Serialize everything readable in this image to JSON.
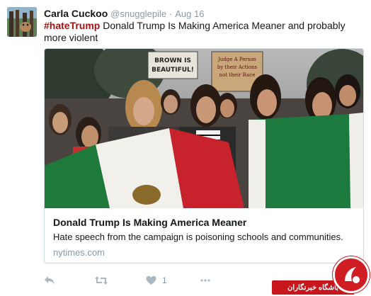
{
  "tweet": {
    "author_name": "Carla Cuckoo",
    "author_handle": "@snugglepile",
    "separator": "·",
    "timestamp": "Aug 16",
    "hashtag": "#hateTrump",
    "text": " Donald Trump Is Making America Meaner and probably more violent"
  },
  "card": {
    "image_signs": [
      "BROWN IS BEAUTIFUL!",
      "Judge A Person by their Actions not their Race"
    ],
    "title": "Donald Trump Is Making America Meaner",
    "description": "Hate speech from the campaign is poisoning schools and communities.",
    "domain": "nytimes.com"
  },
  "actions": {
    "reply_icon": "reply-icon",
    "retweet_icon": "retweet-icon",
    "like_icon": "heart-icon",
    "like_count": "1",
    "more_icon": "more-icon"
  },
  "watermark": {
    "label": "باشگاه خبرنگاران"
  },
  "colors": {
    "hashtag": "#a11414",
    "meta_gray": "#8899a6",
    "icon_gray": "#aab8c2",
    "watermark_red": "#c8161d"
  }
}
